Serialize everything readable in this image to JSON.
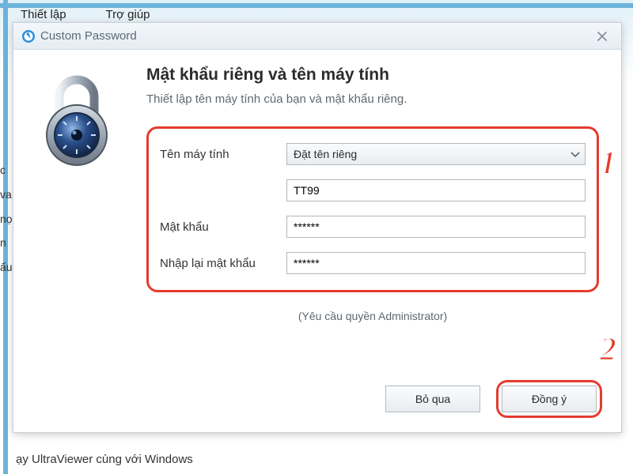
{
  "menu": {
    "setup": "Thiết lập",
    "help": "Trợ giúp"
  },
  "bg": {
    "side_lines": [
      "c",
      " va",
      "nọ",
      " n",
      "ấu"
    ],
    "bottom": "ạy UltraViewer cùng với Windows"
  },
  "dialog": {
    "title": "Custom Password",
    "heading": "Mật khẩu riêng và tên máy tính",
    "subheading": "Thiết lập tên máy tính của bạn và mật khẩu riêng.",
    "labels": {
      "computer_name": "Tên máy tính",
      "password": "Mật khẩu",
      "confirm_password": "Nhập lại mật khẩu"
    },
    "select": {
      "value": "Đặt tên riêng"
    },
    "inputs": {
      "computer_name_value": "TT99",
      "password_value": "******",
      "confirm_value": "******"
    },
    "admin_note": "(Yêu cầu quyền Administrator)",
    "buttons": {
      "skip": "Bỏ qua",
      "ok": "Đồng ý"
    }
  },
  "annotations": {
    "one": "1",
    "two": "2"
  }
}
